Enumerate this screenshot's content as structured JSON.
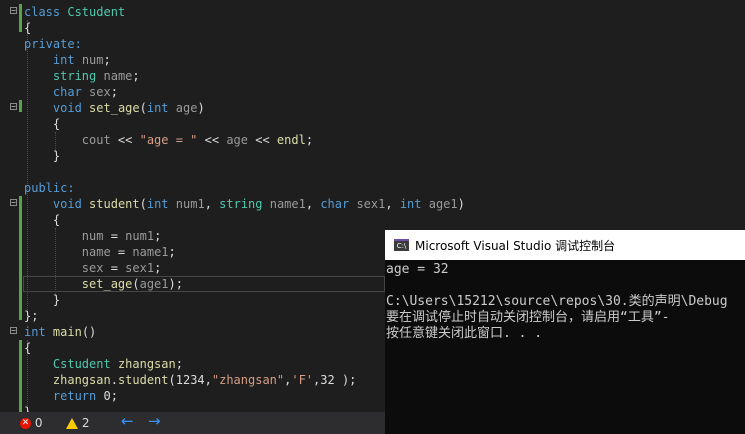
{
  "editor": {
    "lines": [
      [
        {
          "t": "class ",
          "c": "kw"
        },
        {
          "t": "Cstudent",
          "c": "ty"
        }
      ],
      [
        {
          "t": "{"
        }
      ],
      [
        {
          "t": "private:",
          "c": "kw"
        }
      ],
      [
        {
          "t": "    "
        },
        {
          "t": "int",
          "c": "kw"
        },
        {
          "t": " "
        },
        {
          "t": "num",
          "c": "pm"
        },
        {
          "t": ";"
        }
      ],
      [
        {
          "t": "    "
        },
        {
          "t": "string",
          "c": "ty"
        },
        {
          "t": " "
        },
        {
          "t": "name",
          "c": "pm"
        },
        {
          "t": ";"
        }
      ],
      [
        {
          "t": "    "
        },
        {
          "t": "char",
          "c": "kw"
        },
        {
          "t": " "
        },
        {
          "t": "sex",
          "c": "pm"
        },
        {
          "t": ";"
        }
      ],
      [
        {
          "t": "    "
        },
        {
          "t": "void",
          "c": "kw"
        },
        {
          "t": " "
        },
        {
          "t": "set_age",
          "c": "fn"
        },
        {
          "t": "("
        },
        {
          "t": "int",
          "c": "kw"
        },
        {
          "t": " "
        },
        {
          "t": "age",
          "c": "pm"
        },
        {
          "t": ")"
        }
      ],
      [
        {
          "t": "    {"
        }
      ],
      [
        {
          "t": "        "
        },
        {
          "t": "cout",
          "c": "pm"
        },
        {
          "t": " << "
        },
        {
          "t": "\"age = \"",
          "c": "str"
        },
        {
          "t": " << "
        },
        {
          "t": "age",
          "c": "pm"
        },
        {
          "t": " << "
        },
        {
          "t": "endl",
          "c": "fn"
        },
        {
          "t": ";"
        }
      ],
      [
        {
          "t": "    }"
        }
      ],
      [
        {
          "t": ""
        }
      ],
      [
        {
          "t": "public:",
          "c": "kw"
        }
      ],
      [
        {
          "t": "    "
        },
        {
          "t": "void",
          "c": "kw"
        },
        {
          "t": " "
        },
        {
          "t": "student",
          "c": "fn"
        },
        {
          "t": "("
        },
        {
          "t": "int",
          "c": "kw"
        },
        {
          "t": " "
        },
        {
          "t": "num1",
          "c": "pm"
        },
        {
          "t": ", "
        },
        {
          "t": "string",
          "c": "ty"
        },
        {
          "t": " "
        },
        {
          "t": "name1",
          "c": "pm"
        },
        {
          "t": ", "
        },
        {
          "t": "char",
          "c": "kw"
        },
        {
          "t": " "
        },
        {
          "t": "sex1",
          "c": "pm"
        },
        {
          "t": ", "
        },
        {
          "t": "int",
          "c": "kw"
        },
        {
          "t": " "
        },
        {
          "t": "age1",
          "c": "pm"
        },
        {
          "t": ")"
        }
      ],
      [
        {
          "t": "    {"
        }
      ],
      [
        {
          "t": "        "
        },
        {
          "t": "num",
          "c": "pm"
        },
        {
          "t": " = "
        },
        {
          "t": "num1",
          "c": "pm"
        },
        {
          "t": ";"
        }
      ],
      [
        {
          "t": "        "
        },
        {
          "t": "name",
          "c": "pm"
        },
        {
          "t": " = "
        },
        {
          "t": "name1",
          "c": "pm"
        },
        {
          "t": ";"
        }
      ],
      [
        {
          "t": "        "
        },
        {
          "t": "sex",
          "c": "pm"
        },
        {
          "t": " = "
        },
        {
          "t": "sex1",
          "c": "pm"
        },
        {
          "t": ";"
        }
      ],
      [
        {
          "t": "        "
        },
        {
          "t": "set_age",
          "c": "fn"
        },
        {
          "t": "("
        },
        {
          "t": "age1",
          "c": "pm"
        },
        {
          "t": ");"
        }
      ],
      [
        {
          "t": "    }"
        }
      ],
      [
        {
          "t": "};"
        }
      ],
      [
        {
          "t": "int",
          "c": "kw"
        },
        {
          "t": " "
        },
        {
          "t": "main",
          "c": "fn"
        },
        {
          "t": "()"
        }
      ],
      [
        {
          "t": "{"
        }
      ],
      [
        {
          "t": "    "
        },
        {
          "t": "Cstudent",
          "c": "ty"
        },
        {
          "t": " "
        },
        {
          "t": "zhangsan",
          "c": "fn"
        },
        {
          "t": ";"
        }
      ],
      [
        {
          "t": "    "
        },
        {
          "t": "zhangsan",
          "c": "fn"
        },
        {
          "t": "."
        },
        {
          "t": "student",
          "c": "fn"
        },
        {
          "t": "(1234,"
        },
        {
          "t": "\"zhangsan\"",
          "c": "str"
        },
        {
          "t": ","
        },
        {
          "t": "'F'",
          "c": "str"
        },
        {
          "t": ",32 );"
        }
      ],
      [
        {
          "t": "    "
        },
        {
          "t": "return",
          "c": "kw"
        },
        {
          "t": " 0;"
        }
      ],
      [
        {
          "t": "}"
        }
      ]
    ]
  },
  "status": {
    "errors": "0",
    "warnings": "2"
  },
  "console": {
    "title": "Microsoft Visual Studio 调试控制台",
    "icon_label": "C:\\",
    "lines": [
      "age = 32",
      "",
      "C:\\Users\\15212\\source\\repos\\30.类的声明\\Debug",
      "要在调试停止时自动关闭控制台，请启用“工具”-",
      "按任意键关闭此窗口. . ."
    ]
  },
  "colors": {
    "keyword": "#569cd6",
    "type": "#4ec9b0",
    "function": "#dcdcaa",
    "string": "#d69d85",
    "change-bar": "#57a64a"
  }
}
